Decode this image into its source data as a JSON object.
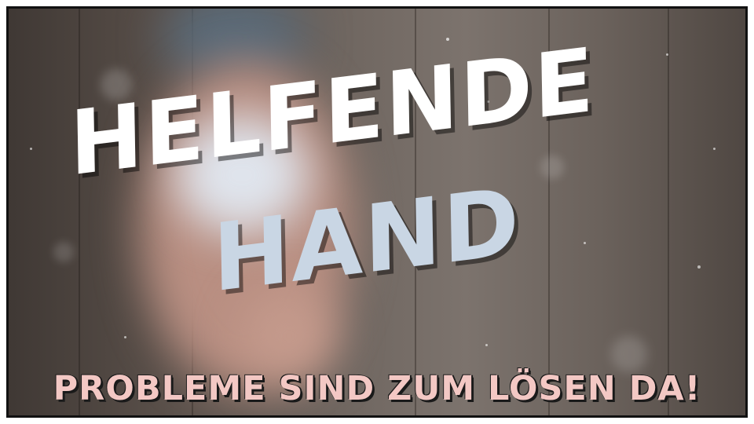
{
  "headline": {
    "line1": "HELFENDE",
    "line2": "HAND"
  },
  "tagline": "PROBLEME SIND ZUM LÖSEN DA!",
  "colors": {
    "line1": "#ffffff",
    "line2": "#c9d6e4",
    "tagline": "#f3c8c4",
    "frame": "#111111",
    "background_wood": "#6f6660"
  }
}
